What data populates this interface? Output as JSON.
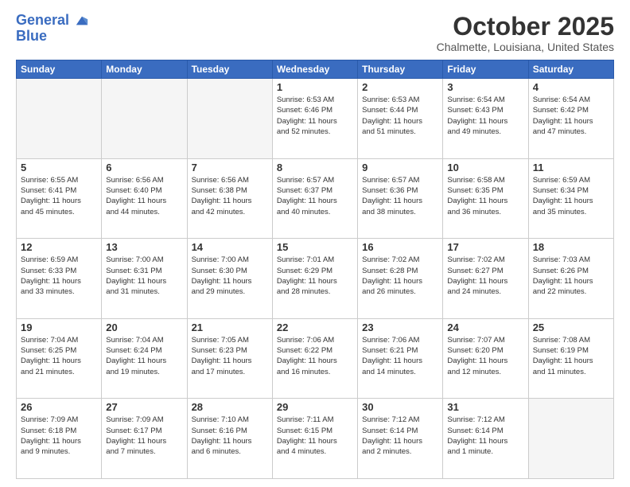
{
  "header": {
    "logo_line1": "General",
    "logo_line2": "Blue",
    "month": "October 2025",
    "location": "Chalmette, Louisiana, United States"
  },
  "weekdays": [
    "Sunday",
    "Monday",
    "Tuesday",
    "Wednesday",
    "Thursday",
    "Friday",
    "Saturday"
  ],
  "weeks": [
    [
      {
        "day": "",
        "info": ""
      },
      {
        "day": "",
        "info": ""
      },
      {
        "day": "",
        "info": ""
      },
      {
        "day": "1",
        "info": "Sunrise: 6:53 AM\nSunset: 6:46 PM\nDaylight: 11 hours\nand 52 minutes."
      },
      {
        "day": "2",
        "info": "Sunrise: 6:53 AM\nSunset: 6:44 PM\nDaylight: 11 hours\nand 51 minutes."
      },
      {
        "day": "3",
        "info": "Sunrise: 6:54 AM\nSunset: 6:43 PM\nDaylight: 11 hours\nand 49 minutes."
      },
      {
        "day": "4",
        "info": "Sunrise: 6:54 AM\nSunset: 6:42 PM\nDaylight: 11 hours\nand 47 minutes."
      }
    ],
    [
      {
        "day": "5",
        "info": "Sunrise: 6:55 AM\nSunset: 6:41 PM\nDaylight: 11 hours\nand 45 minutes."
      },
      {
        "day": "6",
        "info": "Sunrise: 6:56 AM\nSunset: 6:40 PM\nDaylight: 11 hours\nand 44 minutes."
      },
      {
        "day": "7",
        "info": "Sunrise: 6:56 AM\nSunset: 6:38 PM\nDaylight: 11 hours\nand 42 minutes."
      },
      {
        "day": "8",
        "info": "Sunrise: 6:57 AM\nSunset: 6:37 PM\nDaylight: 11 hours\nand 40 minutes."
      },
      {
        "day": "9",
        "info": "Sunrise: 6:57 AM\nSunset: 6:36 PM\nDaylight: 11 hours\nand 38 minutes."
      },
      {
        "day": "10",
        "info": "Sunrise: 6:58 AM\nSunset: 6:35 PM\nDaylight: 11 hours\nand 36 minutes."
      },
      {
        "day": "11",
        "info": "Sunrise: 6:59 AM\nSunset: 6:34 PM\nDaylight: 11 hours\nand 35 minutes."
      }
    ],
    [
      {
        "day": "12",
        "info": "Sunrise: 6:59 AM\nSunset: 6:33 PM\nDaylight: 11 hours\nand 33 minutes."
      },
      {
        "day": "13",
        "info": "Sunrise: 7:00 AM\nSunset: 6:31 PM\nDaylight: 11 hours\nand 31 minutes."
      },
      {
        "day": "14",
        "info": "Sunrise: 7:00 AM\nSunset: 6:30 PM\nDaylight: 11 hours\nand 29 minutes."
      },
      {
        "day": "15",
        "info": "Sunrise: 7:01 AM\nSunset: 6:29 PM\nDaylight: 11 hours\nand 28 minutes."
      },
      {
        "day": "16",
        "info": "Sunrise: 7:02 AM\nSunset: 6:28 PM\nDaylight: 11 hours\nand 26 minutes."
      },
      {
        "day": "17",
        "info": "Sunrise: 7:02 AM\nSunset: 6:27 PM\nDaylight: 11 hours\nand 24 minutes."
      },
      {
        "day": "18",
        "info": "Sunrise: 7:03 AM\nSunset: 6:26 PM\nDaylight: 11 hours\nand 22 minutes."
      }
    ],
    [
      {
        "day": "19",
        "info": "Sunrise: 7:04 AM\nSunset: 6:25 PM\nDaylight: 11 hours\nand 21 minutes."
      },
      {
        "day": "20",
        "info": "Sunrise: 7:04 AM\nSunset: 6:24 PM\nDaylight: 11 hours\nand 19 minutes."
      },
      {
        "day": "21",
        "info": "Sunrise: 7:05 AM\nSunset: 6:23 PM\nDaylight: 11 hours\nand 17 minutes."
      },
      {
        "day": "22",
        "info": "Sunrise: 7:06 AM\nSunset: 6:22 PM\nDaylight: 11 hours\nand 16 minutes."
      },
      {
        "day": "23",
        "info": "Sunrise: 7:06 AM\nSunset: 6:21 PM\nDaylight: 11 hours\nand 14 minutes."
      },
      {
        "day": "24",
        "info": "Sunrise: 7:07 AM\nSunset: 6:20 PM\nDaylight: 11 hours\nand 12 minutes."
      },
      {
        "day": "25",
        "info": "Sunrise: 7:08 AM\nSunset: 6:19 PM\nDaylight: 11 hours\nand 11 minutes."
      }
    ],
    [
      {
        "day": "26",
        "info": "Sunrise: 7:09 AM\nSunset: 6:18 PM\nDaylight: 11 hours\nand 9 minutes."
      },
      {
        "day": "27",
        "info": "Sunrise: 7:09 AM\nSunset: 6:17 PM\nDaylight: 11 hours\nand 7 minutes."
      },
      {
        "day": "28",
        "info": "Sunrise: 7:10 AM\nSunset: 6:16 PM\nDaylight: 11 hours\nand 6 minutes."
      },
      {
        "day": "29",
        "info": "Sunrise: 7:11 AM\nSunset: 6:15 PM\nDaylight: 11 hours\nand 4 minutes."
      },
      {
        "day": "30",
        "info": "Sunrise: 7:12 AM\nSunset: 6:14 PM\nDaylight: 11 hours\nand 2 minutes."
      },
      {
        "day": "31",
        "info": "Sunrise: 7:12 AM\nSunset: 6:14 PM\nDaylight: 11 hours\nand 1 minute."
      },
      {
        "day": "",
        "info": ""
      }
    ]
  ]
}
